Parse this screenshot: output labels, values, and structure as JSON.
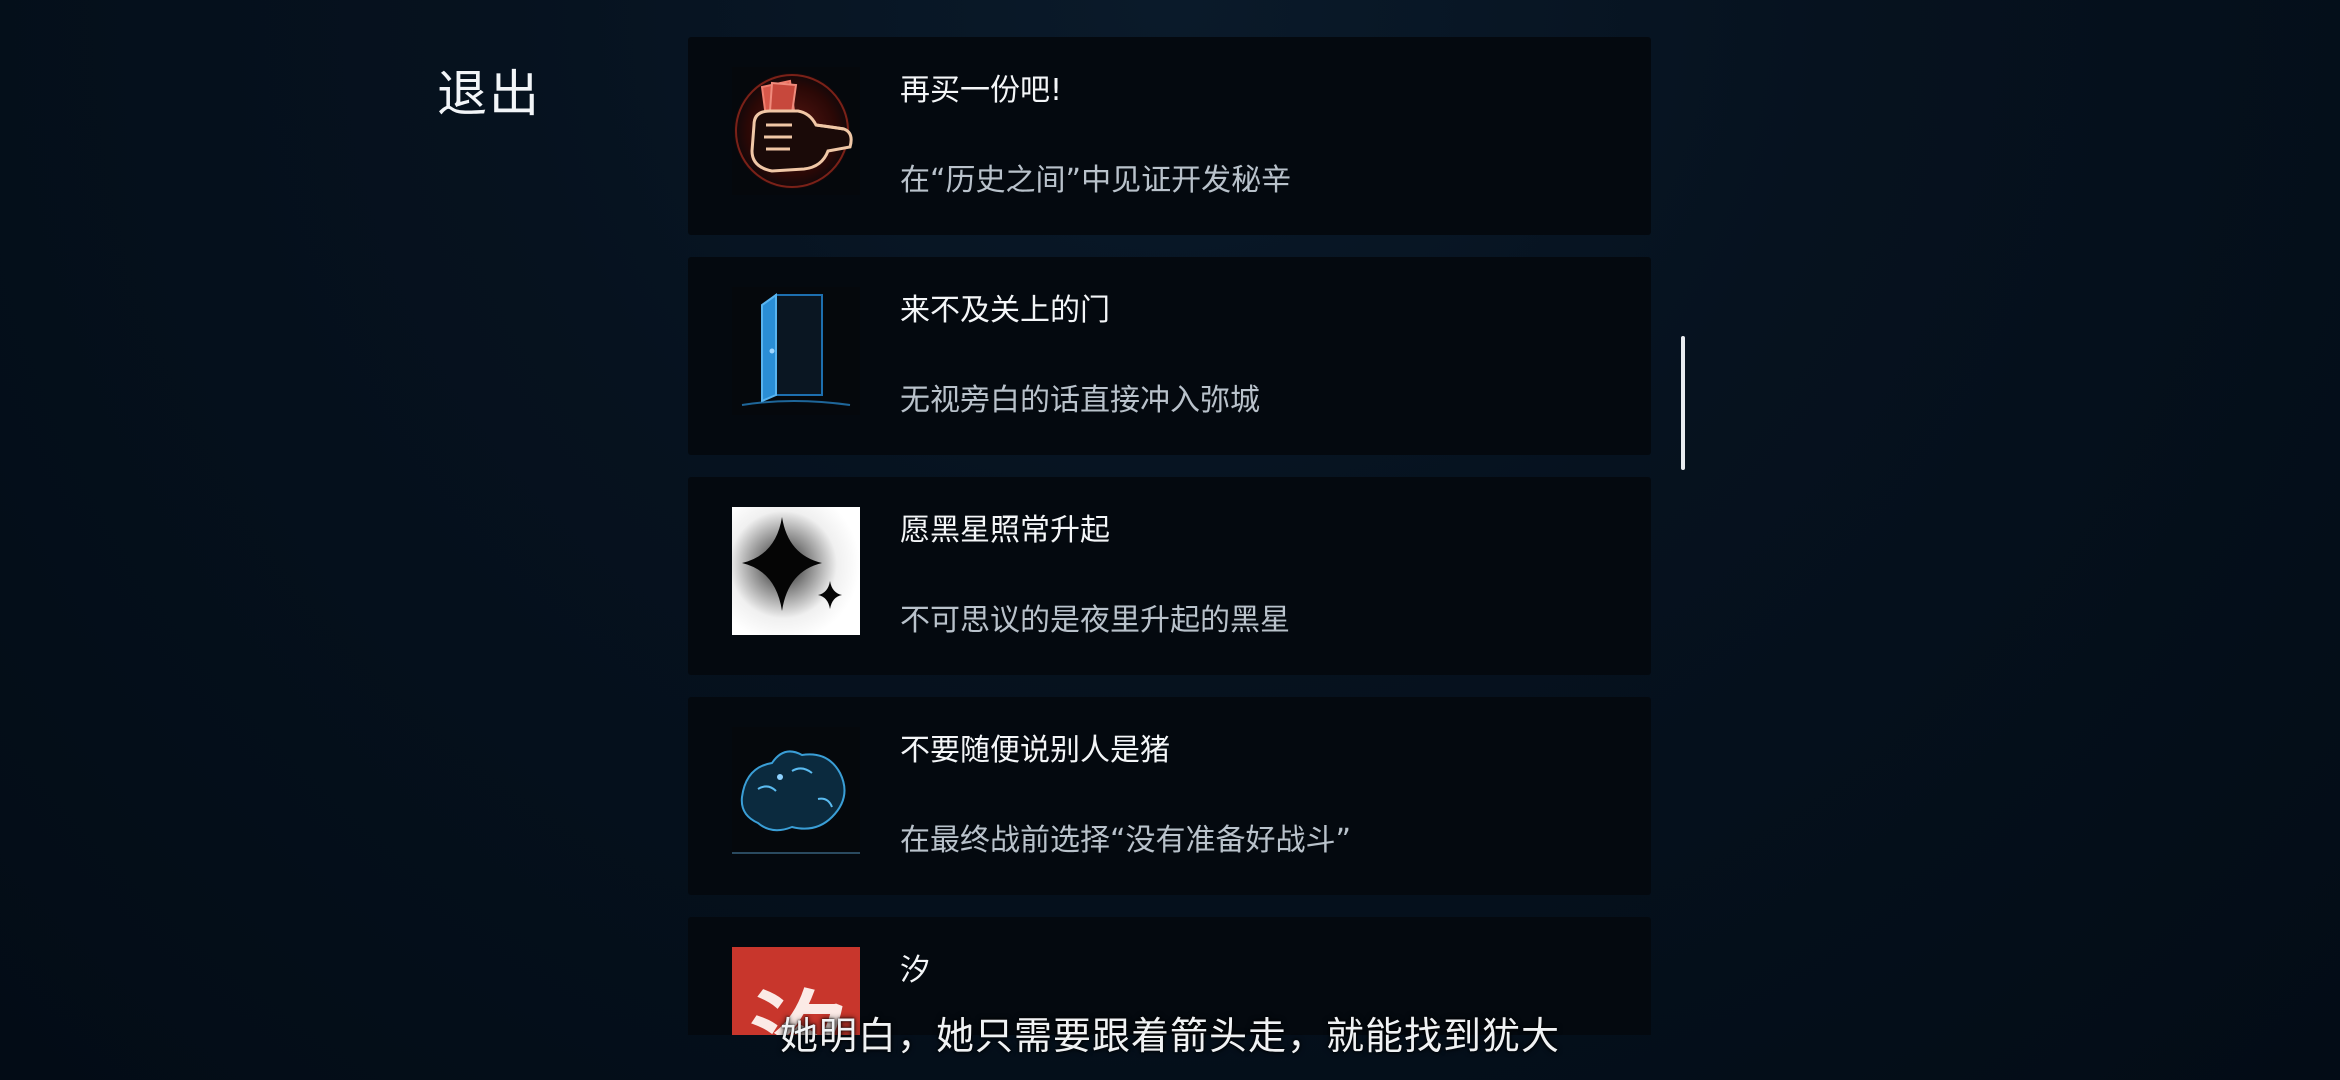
{
  "exit_label": "退出",
  "achievements": [
    {
      "title": "再买一份吧!",
      "desc": "在“历史之间”中见证开发秘辛",
      "icon": "fist-holding-money-icon"
    },
    {
      "title": "来不及关上的门",
      "desc": "无视旁白的话直接冲入弥城",
      "icon": "open-door-icon"
    },
    {
      "title": "愿黑星照常升起",
      "desc": "不可思议的是夜里升起的黑星",
      "icon": "black-star-icon"
    },
    {
      "title": "不要随便说别人是猪",
      "desc": "在最终战前选择“没有准备好战斗”",
      "icon": "pig-silhouette-icon"
    },
    {
      "title": "汐",
      "desc": "",
      "icon": "xi-character-icon",
      "icon_text": "汐"
    }
  ],
  "subtitle": "她明白，她只需要跟着箭头走，就能找到犹大",
  "colors": {
    "background": "#041020",
    "card": "#04090f",
    "accent_red": "#c8362c",
    "accent_blue": "#2a8ed6"
  }
}
